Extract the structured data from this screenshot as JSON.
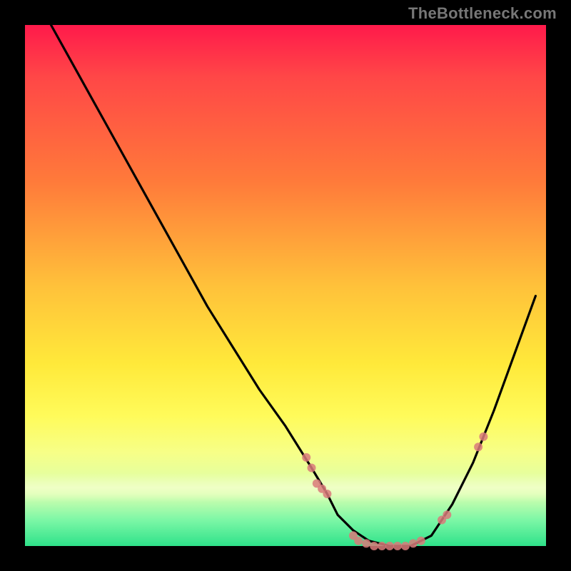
{
  "watermark": "TheBottleneck.com",
  "chart_data": {
    "type": "line",
    "title": "",
    "xlabel": "",
    "ylabel": "",
    "xlim": [
      0,
      100
    ],
    "ylim": [
      0,
      100
    ],
    "grid": false,
    "legend": false,
    "background_gradient": {
      "orientation": "vertical",
      "stops": [
        {
          "pos": 0.0,
          "color": "#ff1a4b"
        },
        {
          "pos": 0.3,
          "color": "#ff7a3a"
        },
        {
          "pos": 0.55,
          "color": "#ffd83a"
        },
        {
          "pos": 0.75,
          "color": "#fffb5a"
        },
        {
          "pos": 0.9,
          "color": "#d8ffb0"
        },
        {
          "pos": 1.0,
          "color": "#2fe28a"
        }
      ]
    },
    "series": [
      {
        "name": "bottleneck-curve",
        "color": "#000000",
        "x": [
          5,
          10,
          15,
          20,
          25,
          30,
          35,
          40,
          45,
          50,
          55,
          58,
          60,
          63,
          66,
          70,
          74,
          78,
          82,
          86,
          90,
          94,
          98
        ],
        "y": [
          100,
          91,
          82,
          73,
          64,
          55,
          46,
          38,
          30,
          23,
          15,
          10,
          6,
          3,
          1,
          0,
          0,
          2,
          8,
          16,
          26,
          37,
          48
        ]
      }
    ],
    "markers": {
      "name": "highlight-points",
      "color": "#d97a7a",
      "radius": 6,
      "points": [
        {
          "x": 54,
          "y": 17
        },
        {
          "x": 55,
          "y": 15
        },
        {
          "x": 56,
          "y": 12
        },
        {
          "x": 57,
          "y": 11
        },
        {
          "x": 58,
          "y": 10
        },
        {
          "x": 63,
          "y": 2
        },
        {
          "x": 64,
          "y": 1
        },
        {
          "x": 65.5,
          "y": 0.5
        },
        {
          "x": 67,
          "y": 0
        },
        {
          "x": 68.5,
          "y": 0
        },
        {
          "x": 70,
          "y": 0
        },
        {
          "x": 71.5,
          "y": 0
        },
        {
          "x": 73,
          "y": 0
        },
        {
          "x": 74.5,
          "y": 0.5
        },
        {
          "x": 76,
          "y": 1
        },
        {
          "x": 80,
          "y": 5
        },
        {
          "x": 81,
          "y": 6
        },
        {
          "x": 87,
          "y": 19
        },
        {
          "x": 88,
          "y": 21
        }
      ]
    }
  }
}
